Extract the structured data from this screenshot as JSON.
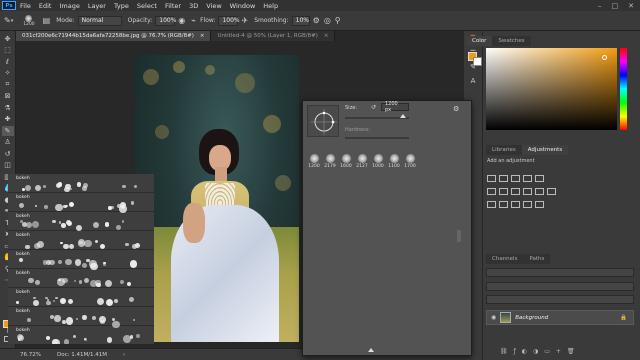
{
  "menu": {
    "logo": "Ps",
    "items": [
      "File",
      "Edit",
      "Image",
      "Layer",
      "Type",
      "Select",
      "Filter",
      "3D",
      "View",
      "Window",
      "Help"
    ]
  },
  "options": {
    "brush_size": "1200",
    "mode_label": "Mode:",
    "mode_value": "Normal",
    "opacity_label": "Opacity:",
    "opacity_value": "100%",
    "flow_label": "Flow:",
    "flow_value": "100%",
    "smoothing_label": "Smoothing:",
    "smoothing_value": "10%"
  },
  "tabs": [
    {
      "label": "031cf200e6c71944b15da6afa72258be.jpg @ 76.7% (RGB/8#)",
      "close": "×"
    },
    {
      "label": "Untitled-4 @ 50% (Layer 1, RGB/8#)",
      "close": "×"
    }
  ],
  "status": {
    "zoom": "76.72%",
    "doc": "Doc: 1.41M/1.41M"
  },
  "brush_picker": {
    "size_label": "Size:",
    "size_value": "1200 px",
    "hardness_label": "Hardness:",
    "presets": [
      "1200",
      "2179",
      "1600",
      "2127",
      "1000",
      "1100",
      "1700"
    ],
    "items": [
      "bokeh",
      "bokeh",
      "bokeh",
      "bokeh",
      "bokeh",
      "bokeh",
      "bokeh",
      "bokeh",
      "bokeh"
    ]
  },
  "right_panel": {
    "color_tabs": [
      "Color",
      "Swatches"
    ],
    "adj_tabs": [
      "Libraries",
      "Adjustments"
    ],
    "add_adjustment": "Add an adjustment",
    "layer_tabs": [
      "Channels",
      "Paths"
    ],
    "layer_name": "Background"
  },
  "colors": {
    "foreground": "#f39c12",
    "background": "#ffffff"
  }
}
